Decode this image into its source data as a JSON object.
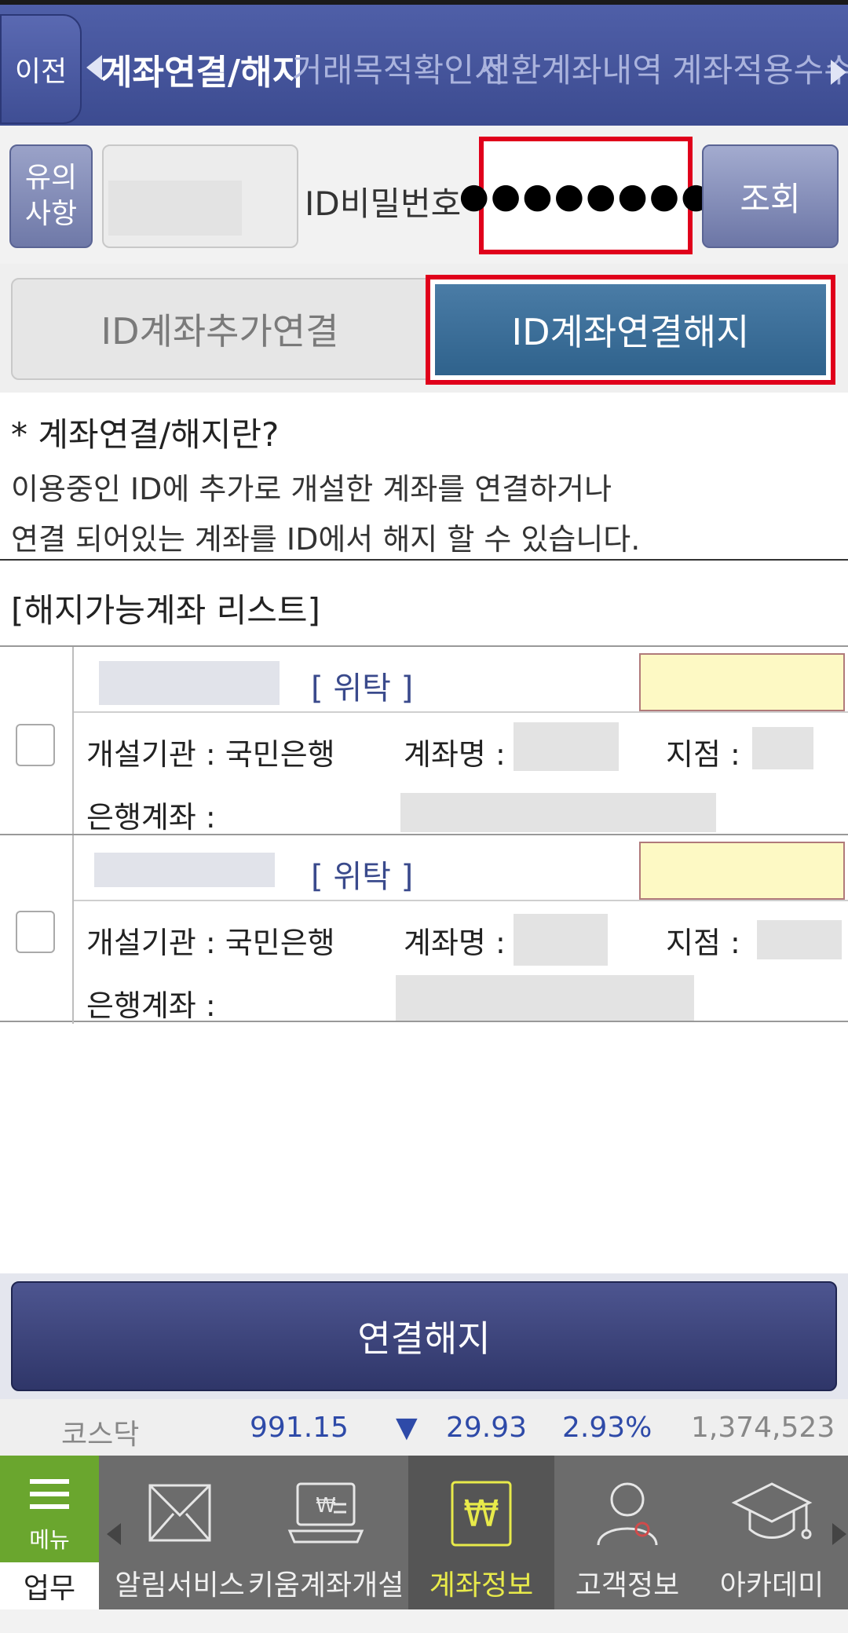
{
  "header": {
    "back_label": "이전",
    "tabs": [
      {
        "label": "계좌연결/해지",
        "active": true
      },
      {
        "label": "거래목적확인서",
        "active": false
      },
      {
        "label": "전환계좌내역",
        "active": false
      },
      {
        "label": "계좌적용수수료",
        "active": false
      }
    ]
  },
  "query": {
    "notice_label": "유의\n사항",
    "password_label": "ID비밀번호",
    "password_value": "●●●●●●●●",
    "search_label": "조회"
  },
  "mode": {
    "add_label": "ID계좌추가연결",
    "cancel_label": "ID계좌연결해지",
    "selected": "ID계좌연결해지"
  },
  "info": {
    "title": "* 계좌연결/해지란?",
    "line1": "이용중인 ID에 추가로 개설한 계좌를 연결하거나",
    "line2": "연결 되어있는 계좌를 ID에서 해지 할 수 있습니다."
  },
  "list": {
    "title": "[해지가능계좌 리스트]",
    "accounts": [
      {
        "type": "[ 위탁 ]",
        "institution_label": "개설기관 : 국민은행",
        "name_label": "계좌명 :",
        "branch_label": "지점 :",
        "bank_account_label": "은행계좌 :",
        "checked": false
      },
      {
        "type": "[ 위탁 ]",
        "institution_label": "개설기관 : 국민은행",
        "name_label": "계좌명 :",
        "branch_label": "지점 :",
        "bank_account_label": "은행계좌 :",
        "checked": false
      }
    ]
  },
  "action": {
    "button_label": "연결해지"
  },
  "ticker": {
    "index_name": "코스닥",
    "value": "991.15",
    "direction_symbol": "▼",
    "change": "29.93",
    "change_pct": "2.93%",
    "volume": "1,374,523"
  },
  "nav": {
    "menu_label": "메뉴",
    "work_label": "업무",
    "items": [
      {
        "label": "알림서비스",
        "icon": "envelope-icon",
        "active": false
      },
      {
        "label": "키움계좌개설",
        "icon": "account-open-icon",
        "active": false
      },
      {
        "label": "계좌정보",
        "icon": "won-wallet-icon",
        "active": true
      },
      {
        "label": "고객정보",
        "icon": "user-icon",
        "active": false
      },
      {
        "label": "아카데미",
        "icon": "graduation-cap-icon",
        "active": false
      }
    ]
  },
  "colors": {
    "header_bg": "#4f5fa8",
    "highlight_red": "#e0001b",
    "cancel_tab_bg": "#3a6e98",
    "main_button_bg": "#3d4479",
    "ticker_blue": "#2e4aa8",
    "menu_green": "#6aa62e",
    "active_nav_label": "#e8ea4a"
  }
}
